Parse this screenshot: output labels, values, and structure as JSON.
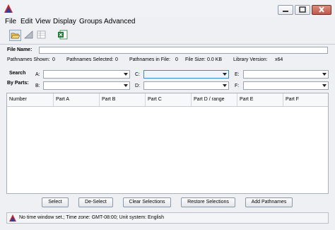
{
  "menu": [
    "File",
    "Edit",
    "View",
    "Display",
    "Groups",
    "Advanced"
  ],
  "file_name_label": "File Name:",
  "file_name_value": "",
  "info": {
    "pathnames_shown": "Pathnames Shown:",
    "pathnames_shown_value": "0",
    "pathnames_selected": "Pathnames Selected:",
    "pathnames_selected_value": "0",
    "pathnames_in_file": "Pathnames in File:",
    "pathnames_in_file_value": "0",
    "file_size": "File Size:",
    "file_size_value": "0.0  KB",
    "library_version": "Library Version:",
    "library_version_value": "x64"
  },
  "search": {
    "label1": "Search",
    "label2": "By Parts:",
    "parts": [
      "A:",
      "B:",
      "C:",
      "D:",
      "E:",
      "F:"
    ]
  },
  "table": {
    "columns": [
      "Number",
      "Part A",
      "Part B",
      "Part C",
      "Part D / range",
      "Part E",
      "Part F"
    ]
  },
  "buttons": [
    "Select",
    "De-Select",
    "Clear Selections",
    "Restore Selections",
    "Add Pathnames"
  ],
  "status": "No time window set.;  Time zone: GMT-08:00;  Unit system: English",
  "colors": {
    "accent": "#3c86d6",
    "logo_red": "#c8262e",
    "logo_blue": "#2b3f9c",
    "excel_green": "#1e7b34"
  }
}
